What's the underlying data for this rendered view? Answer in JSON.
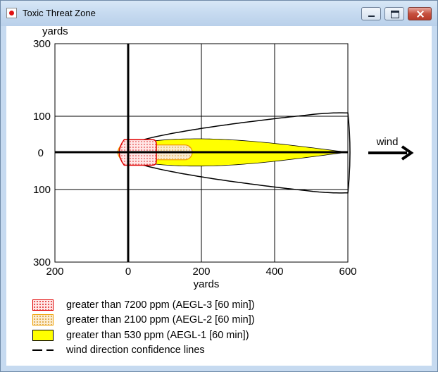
{
  "window": {
    "title": "Toxic Threat Zone"
  },
  "plot": {
    "y_axis_unit": "yards",
    "x_axis_unit": "yards",
    "wind_label": "wind",
    "x_ticks": [
      "200",
      "0",
      "200",
      "400",
      "600"
    ],
    "y_ticks": [
      "300",
      "100",
      "0",
      "100",
      "300"
    ]
  },
  "chart_data": {
    "type": "area",
    "xlabel": "yards",
    "ylabel": "yards",
    "xlim": [
      -200,
      600
    ],
    "ylim": [
      -300,
      300
    ],
    "x_ticks": [
      -200,
      0,
      200,
      400,
      600
    ],
    "y_ticks": [
      -300,
      -100,
      0,
      100,
      300
    ],
    "grid": true,
    "wind_direction": "right",
    "zones": [
      {
        "name": "greater than 7200 ppm (AEGL-3 [60 min])",
        "x_range": [
          -30,
          75
        ],
        "half_width": 35,
        "color": "#ff9999",
        "edge": "#e00000",
        "pattern": "dotted"
      },
      {
        "name": "greater than 2100 ppm (AEGL-2 [60 min])",
        "x_range": [
          -30,
          175
        ],
        "half_width": 45,
        "color": "#f5deb3",
        "edge": "#f0a000",
        "pattern": "dotted"
      },
      {
        "name": "greater than 530 ppm (AEGL-1 [60 min])",
        "x_range": [
          -30,
          600
        ],
        "half_width": 50,
        "color": "#ffff00",
        "edge": "#000000",
        "pattern": "solid"
      }
    ],
    "confidence_lines": {
      "name": "wind direction confidence lines",
      "x_range": [
        -30,
        600
      ],
      "max_half_width": 115
    }
  },
  "legend": {
    "items": [
      {
        "label": "greater than 7200 ppm (AEGL-3 [60 min])",
        "swatch": "red-dotted"
      },
      {
        "label": "greater than 2100 ppm (AEGL-2 [60 min])",
        "swatch": "orange-dotted"
      },
      {
        "label": "greater than 530 ppm (AEGL-1 [60 min])",
        "swatch": "yellow-solid"
      },
      {
        "label": "wind direction confidence lines",
        "swatch": "dashed-line"
      }
    ]
  },
  "colors": {
    "aegl3_edge": "#e00000",
    "aegl2_fill": "#f5deb3",
    "aegl2_edge": "#f0a000",
    "aegl1_fill": "#ffff00",
    "titlebar": "#c6daf0"
  }
}
